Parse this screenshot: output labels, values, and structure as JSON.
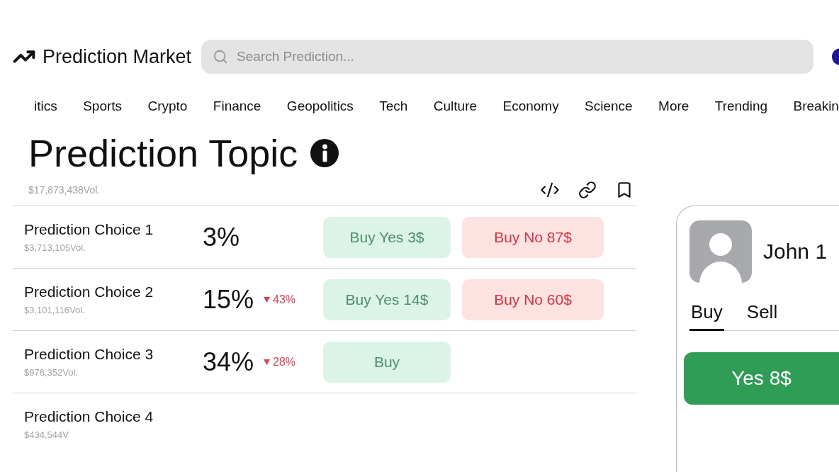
{
  "header": {
    "title": "Prediction Market",
    "search": {
      "placeholder": "Search Prediction..."
    }
  },
  "categories": [
    "itics",
    "Sports",
    "Crypto",
    "Finance",
    "Geopolitics",
    "Tech",
    "Culture",
    "Economy",
    "Science",
    "More",
    "Trending",
    "Breakin"
  ],
  "topic": {
    "title": "Prediction Topic",
    "volume": "$17,873,438Vol."
  },
  "choices": [
    {
      "name": "Prediction Choice 1",
      "volume": "$3,713,105Vol.",
      "percent": "3%",
      "buy_yes": "Buy Yes 3$",
      "buy_no": "Buy No 87$"
    },
    {
      "name": "Prediction Choice 2",
      "volume": "$3,101,116Vol.",
      "percent": "15%",
      "change": {
        "falling": true,
        "text": "43%"
      },
      "buy_yes": "Buy Yes 14$",
      "buy_no": "Buy No 60$"
    },
    {
      "name": "Prediction Choice 3",
      "volume": "$976,352Vol.",
      "percent": "34%",
      "change": {
        "falling": true,
        "text": "28%"
      },
      "buy_yes": "Buy"
    },
    {
      "name": "Prediction Choice 4",
      "volume": "$434,544V"
    }
  ],
  "trade_panel": {
    "user_name": "John 1",
    "tabs": [
      {
        "label": "Buy",
        "selected": true
      },
      {
        "label": "Sell",
        "selected": false
      }
    ],
    "action": "Yes 8$"
  }
}
